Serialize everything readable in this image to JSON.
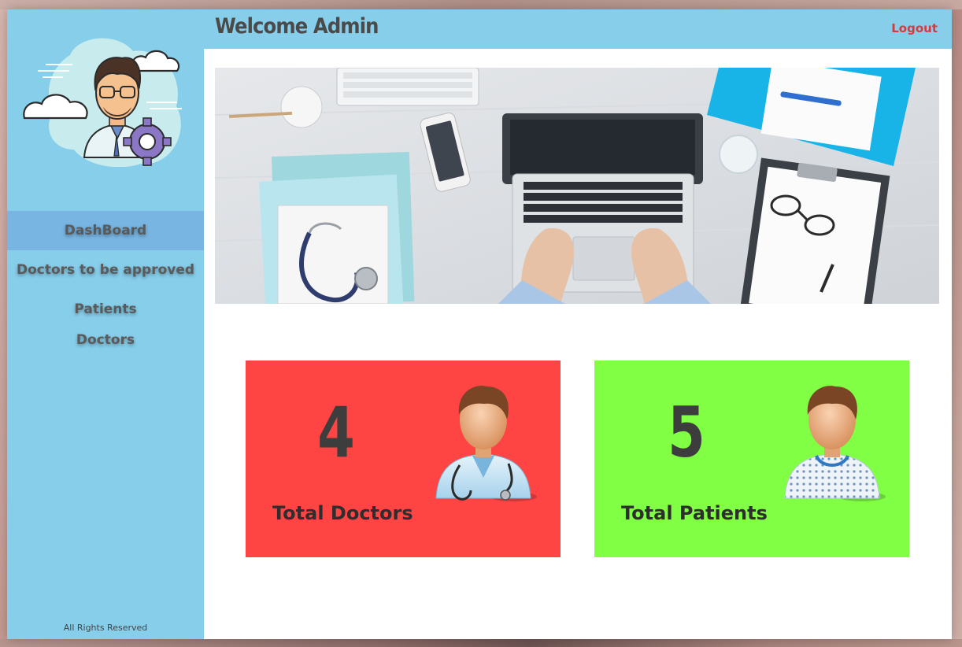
{
  "header": {
    "title": "Welcome Admin",
    "logout_label": "Logout"
  },
  "sidebar": {
    "items": [
      {
        "label": "DashBoard",
        "active": true
      },
      {
        "label": "Doctors to be approved",
        "active": false
      },
      {
        "label": "Patients",
        "active": false
      },
      {
        "label": "Doctors",
        "active": false
      }
    ],
    "footer": "All Rights Reserved"
  },
  "cards": [
    {
      "count": "4",
      "label": "Total Doctors",
      "color": "#ff4444",
      "icon": "doctor-icon"
    },
    {
      "count": "5",
      "label": "Total Patients",
      "color": "#80ff44",
      "icon": "patient-icon"
    }
  ],
  "colors": {
    "sidebar": "#87ceeb",
    "active_item": "#78b5e2",
    "logout": "#d9383c"
  },
  "images": {
    "avatar": "admin-avatar-illustration",
    "banner": "desk-laptop-stethoscope-photo"
  }
}
